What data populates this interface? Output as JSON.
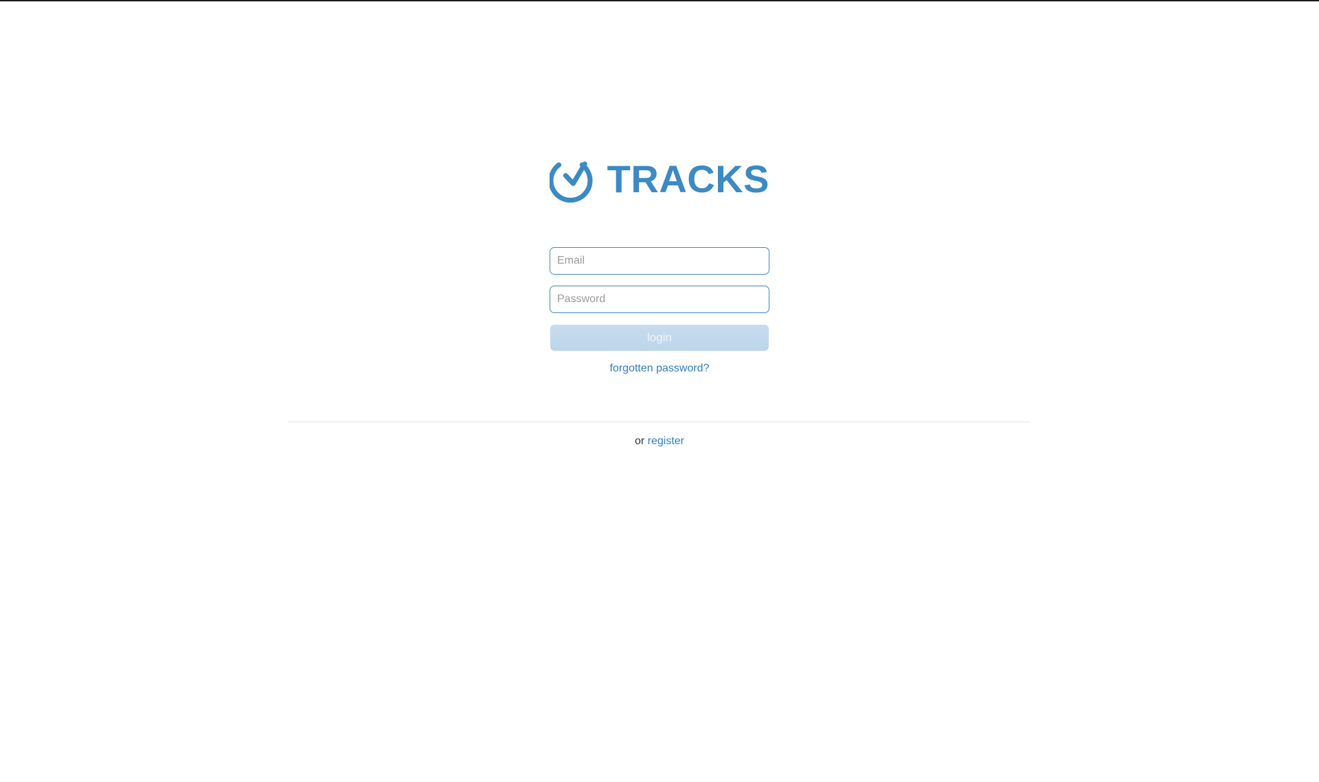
{
  "brand": {
    "name": "TRACKS",
    "color": "#3b8ac4"
  },
  "login_form": {
    "email_placeholder": "Email",
    "password_placeholder": "Password",
    "login_label": "login",
    "forgot_label": "forgotten password?"
  },
  "register": {
    "prefix": "or",
    "link_label": "register"
  },
  "colors": {
    "accent": "#3b8ac4",
    "link": "#2f7fbf",
    "button_disabled": "#c2d9eb",
    "text": "#333333"
  }
}
